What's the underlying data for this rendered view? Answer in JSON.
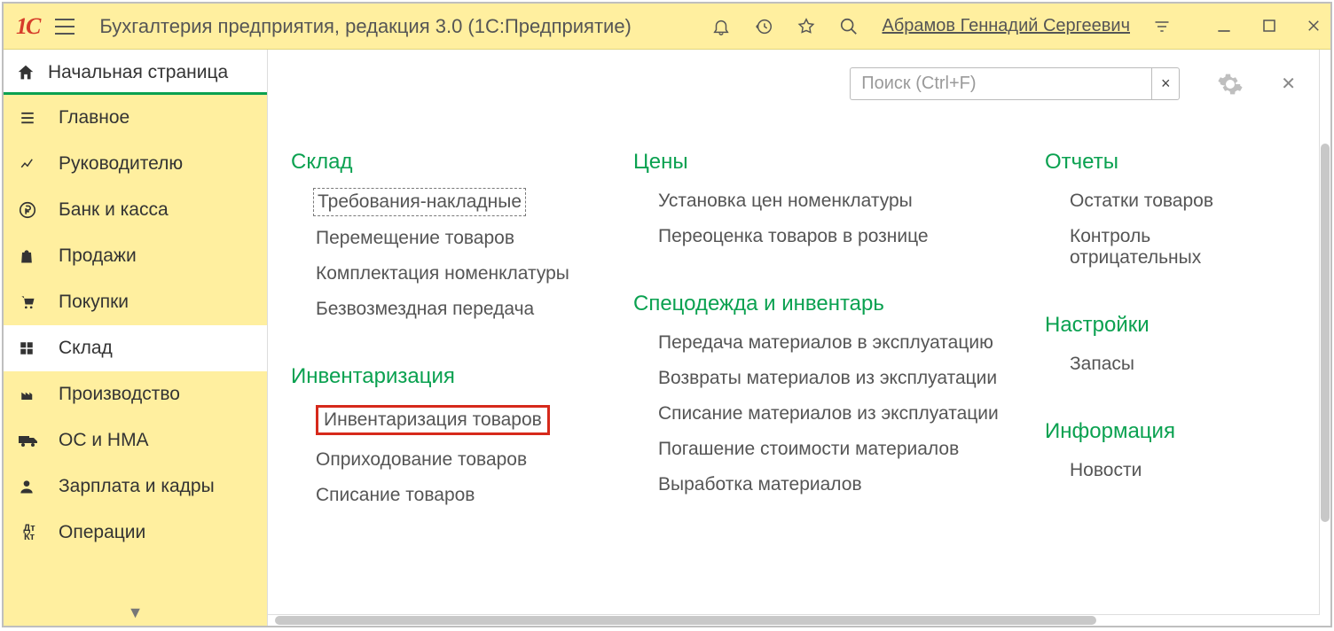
{
  "header": {
    "title": "Бухгалтерия предприятия, редакция 3.0  (1С:Предприятие)",
    "user": "Абрамов Геннадий Сергеевич"
  },
  "tab": {
    "home": "Начальная страница"
  },
  "sidebar": {
    "items": [
      {
        "label": "Главное"
      },
      {
        "label": "Руководителю"
      },
      {
        "label": "Банк и касса"
      },
      {
        "label": "Продажи"
      },
      {
        "label": "Покупки"
      },
      {
        "label": "Склад"
      },
      {
        "label": "Производство"
      },
      {
        "label": "ОС и НМА"
      },
      {
        "label": "Зарплата и кадры"
      },
      {
        "label": "Операции"
      }
    ]
  },
  "search": {
    "placeholder": "Поиск (Ctrl+F)"
  },
  "sections": {
    "sklad": {
      "title": "Склад",
      "links": [
        "Требования-накладные",
        "Перемещение товаров",
        "Комплектация номенклатуры",
        "Безвозмездная передача"
      ]
    },
    "invent": {
      "title": "Инвентаризация",
      "links": [
        "Инвентаризация товаров",
        "Оприходование товаров",
        "Списание товаров"
      ]
    },
    "prices": {
      "title": "Цены",
      "links": [
        "Установка цен номенклатуры",
        "Переоценка товаров в рознице"
      ]
    },
    "spets": {
      "title": "Спецодежда и инвентарь",
      "links": [
        "Передача материалов в эксплуатацию",
        "Возвраты материалов из эксплуатации",
        "Списание материалов из эксплуатации",
        "Погашение стоимости материалов",
        "Выработка материалов"
      ]
    },
    "reports": {
      "title": "Отчеты",
      "links": [
        "Остатки товаров",
        "Контроль отрицательных"
      ]
    },
    "settings": {
      "title": "Настройки",
      "links": [
        "Запасы"
      ]
    },
    "info": {
      "title": "Информация",
      "links": [
        "Новости"
      ]
    }
  }
}
